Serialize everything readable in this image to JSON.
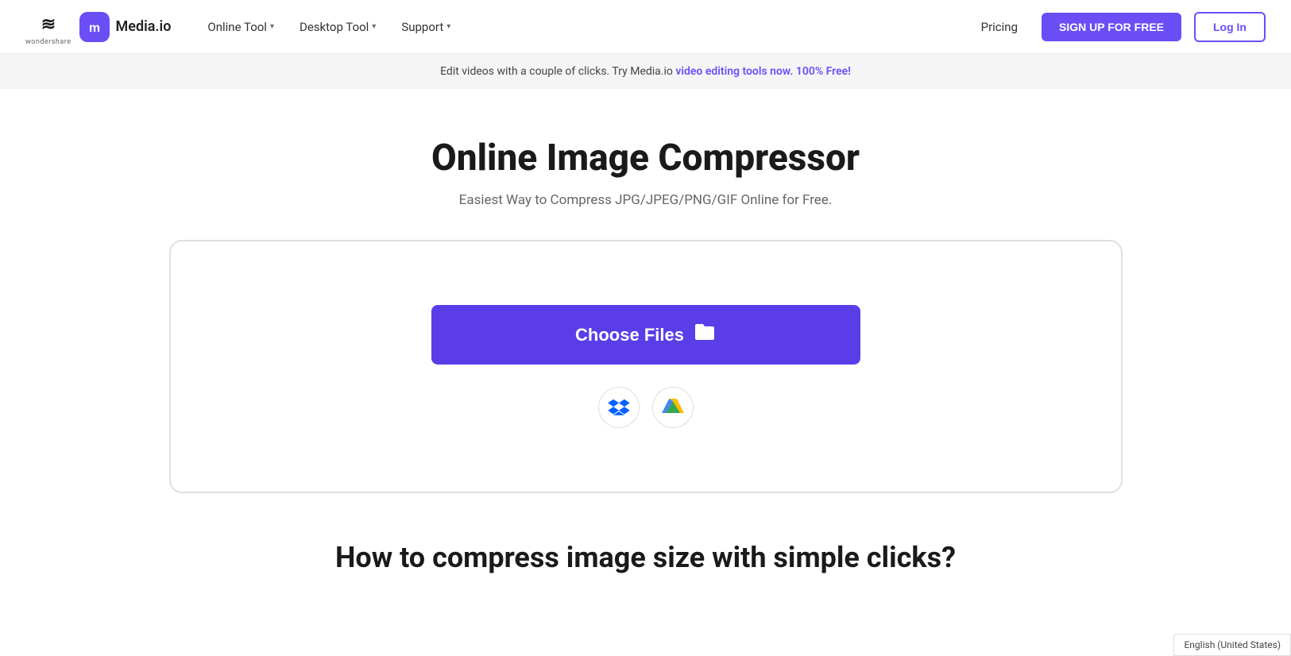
{
  "navbar": {
    "wondershare_label": "wondershare",
    "media_icon": "m",
    "media_name": "Media.io",
    "nav_items": [
      {
        "label": "Online Tool",
        "has_dropdown": true
      },
      {
        "label": "Desktop Tool",
        "has_dropdown": true
      },
      {
        "label": "Support",
        "has_dropdown": true
      }
    ],
    "pricing_label": "Pricing",
    "signup_label": "SIGN UP FOR FREE",
    "login_label": "Log In"
  },
  "banner": {
    "text": "Edit videos with a couple of clicks. Try Media.io ",
    "link_text": "video editing tools now. 100% Free!"
  },
  "main": {
    "title": "Online Image Compressor",
    "subtitle": "Easiest Way to Compress JPG/JPEG/PNG/GIF Online for Free.",
    "choose_files_label": "Choose Files",
    "dropbox_label": "Dropbox",
    "gdrive_label": "Google Drive"
  },
  "bottom": {
    "title": "How to compress image size with simple clicks?"
  },
  "footer": {
    "language": "English (United States)"
  }
}
